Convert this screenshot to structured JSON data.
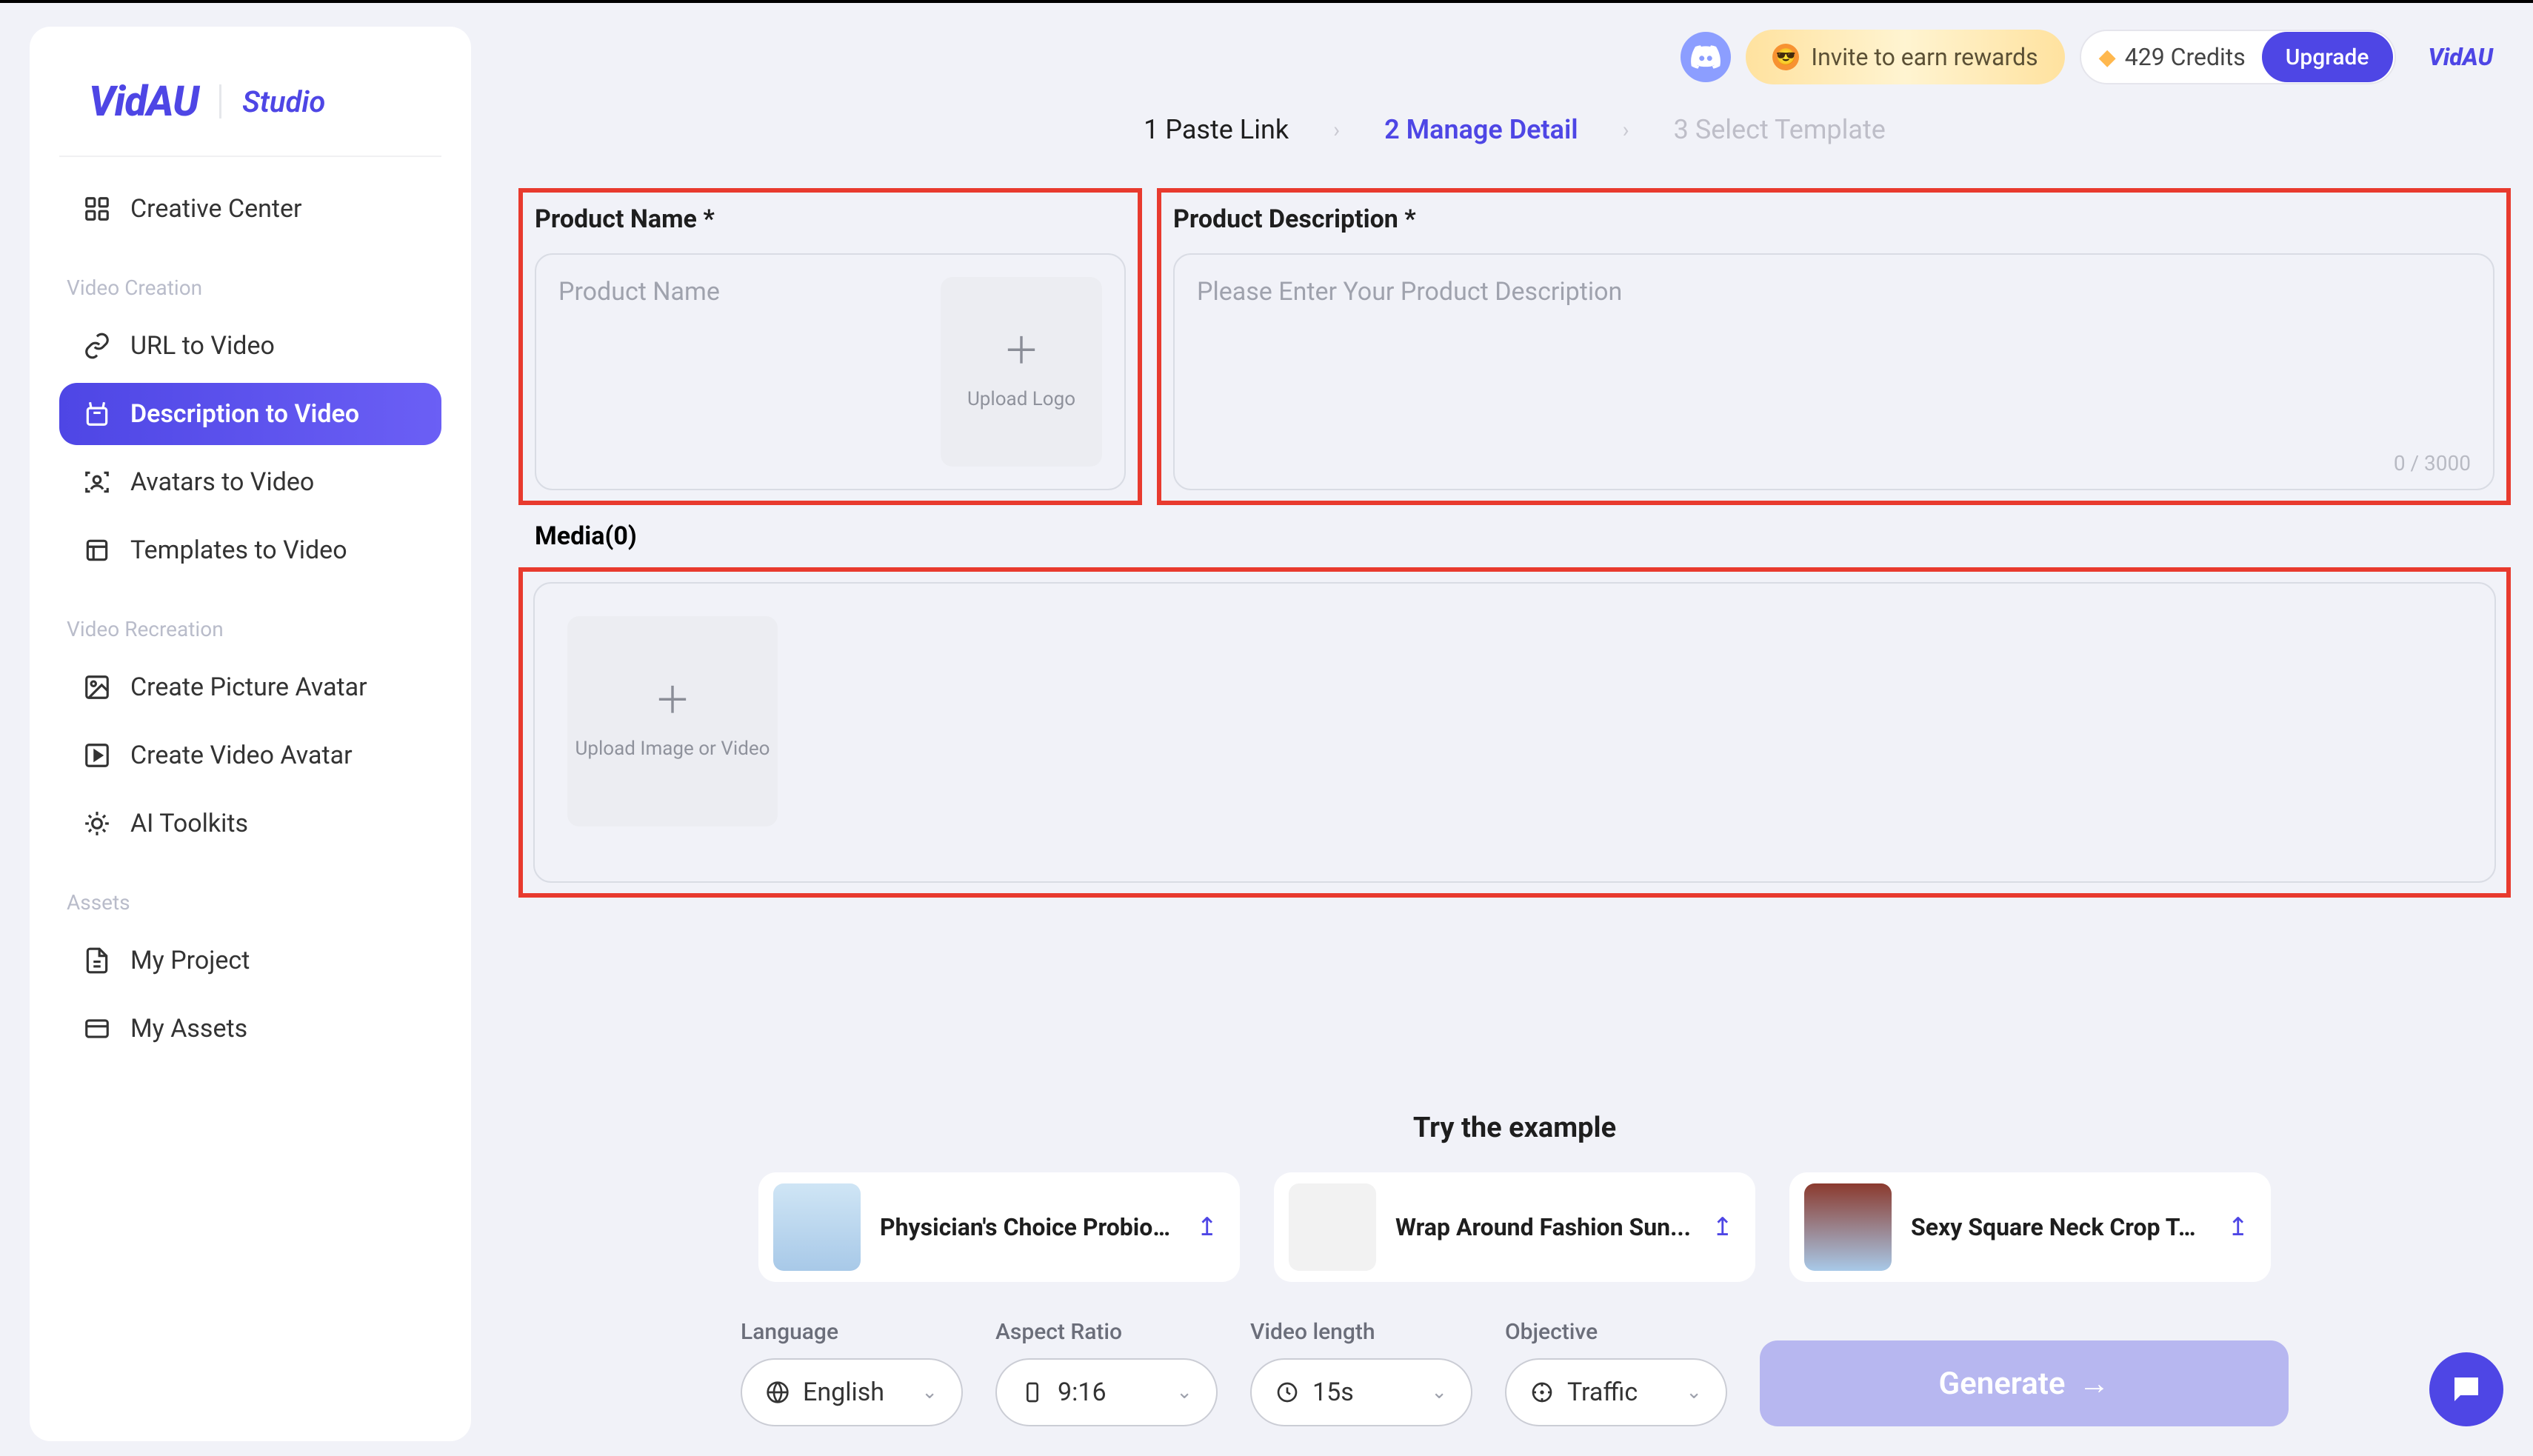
{
  "brand": {
    "main": "VidAU",
    "sub": "Studio"
  },
  "sidebar": {
    "top_item": "Creative Center",
    "sections": [
      {
        "title": "Video Creation",
        "items": [
          "URL to Video",
          "Description to Video",
          "Avatars to Video",
          "Templates to Video"
        ],
        "active_index": 1
      },
      {
        "title": "Video Recreation",
        "items": [
          "Create Picture Avatar",
          "Create Video Avatar",
          "AI Toolkits"
        ]
      },
      {
        "title": "Assets",
        "items": [
          "My Project",
          "My Assets"
        ]
      }
    ]
  },
  "topbar": {
    "invite": "Invite to earn rewards",
    "credits": "429 Credits",
    "upgrade": "Upgrade"
  },
  "steps": [
    "1 Paste Link",
    "2 Manage Detail",
    "3 Select Template"
  ],
  "form": {
    "name_label": "Product Name *",
    "name_placeholder": "Product Name",
    "upload_logo": "Upload Logo",
    "desc_label": "Product Description *",
    "desc_placeholder": "Please Enter Your Product Description",
    "char_count": "0 / 3000",
    "media_label": "Media(0)",
    "upload_media": "Upload Image or Video"
  },
  "examples": {
    "title": "Try the example",
    "items": [
      "Physician's Choice Probiot...",
      "Wrap Around Fashion Sun...",
      "Sexy Square Neck Crop To..."
    ]
  },
  "controls": {
    "language": {
      "label": "Language",
      "value": "English"
    },
    "ratio": {
      "label": "Aspect Ratio",
      "value": "9:16"
    },
    "length": {
      "label": "Video length",
      "value": "15s"
    },
    "objective": {
      "label": "Objective",
      "value": "Traffic"
    },
    "generate": "Generate"
  }
}
